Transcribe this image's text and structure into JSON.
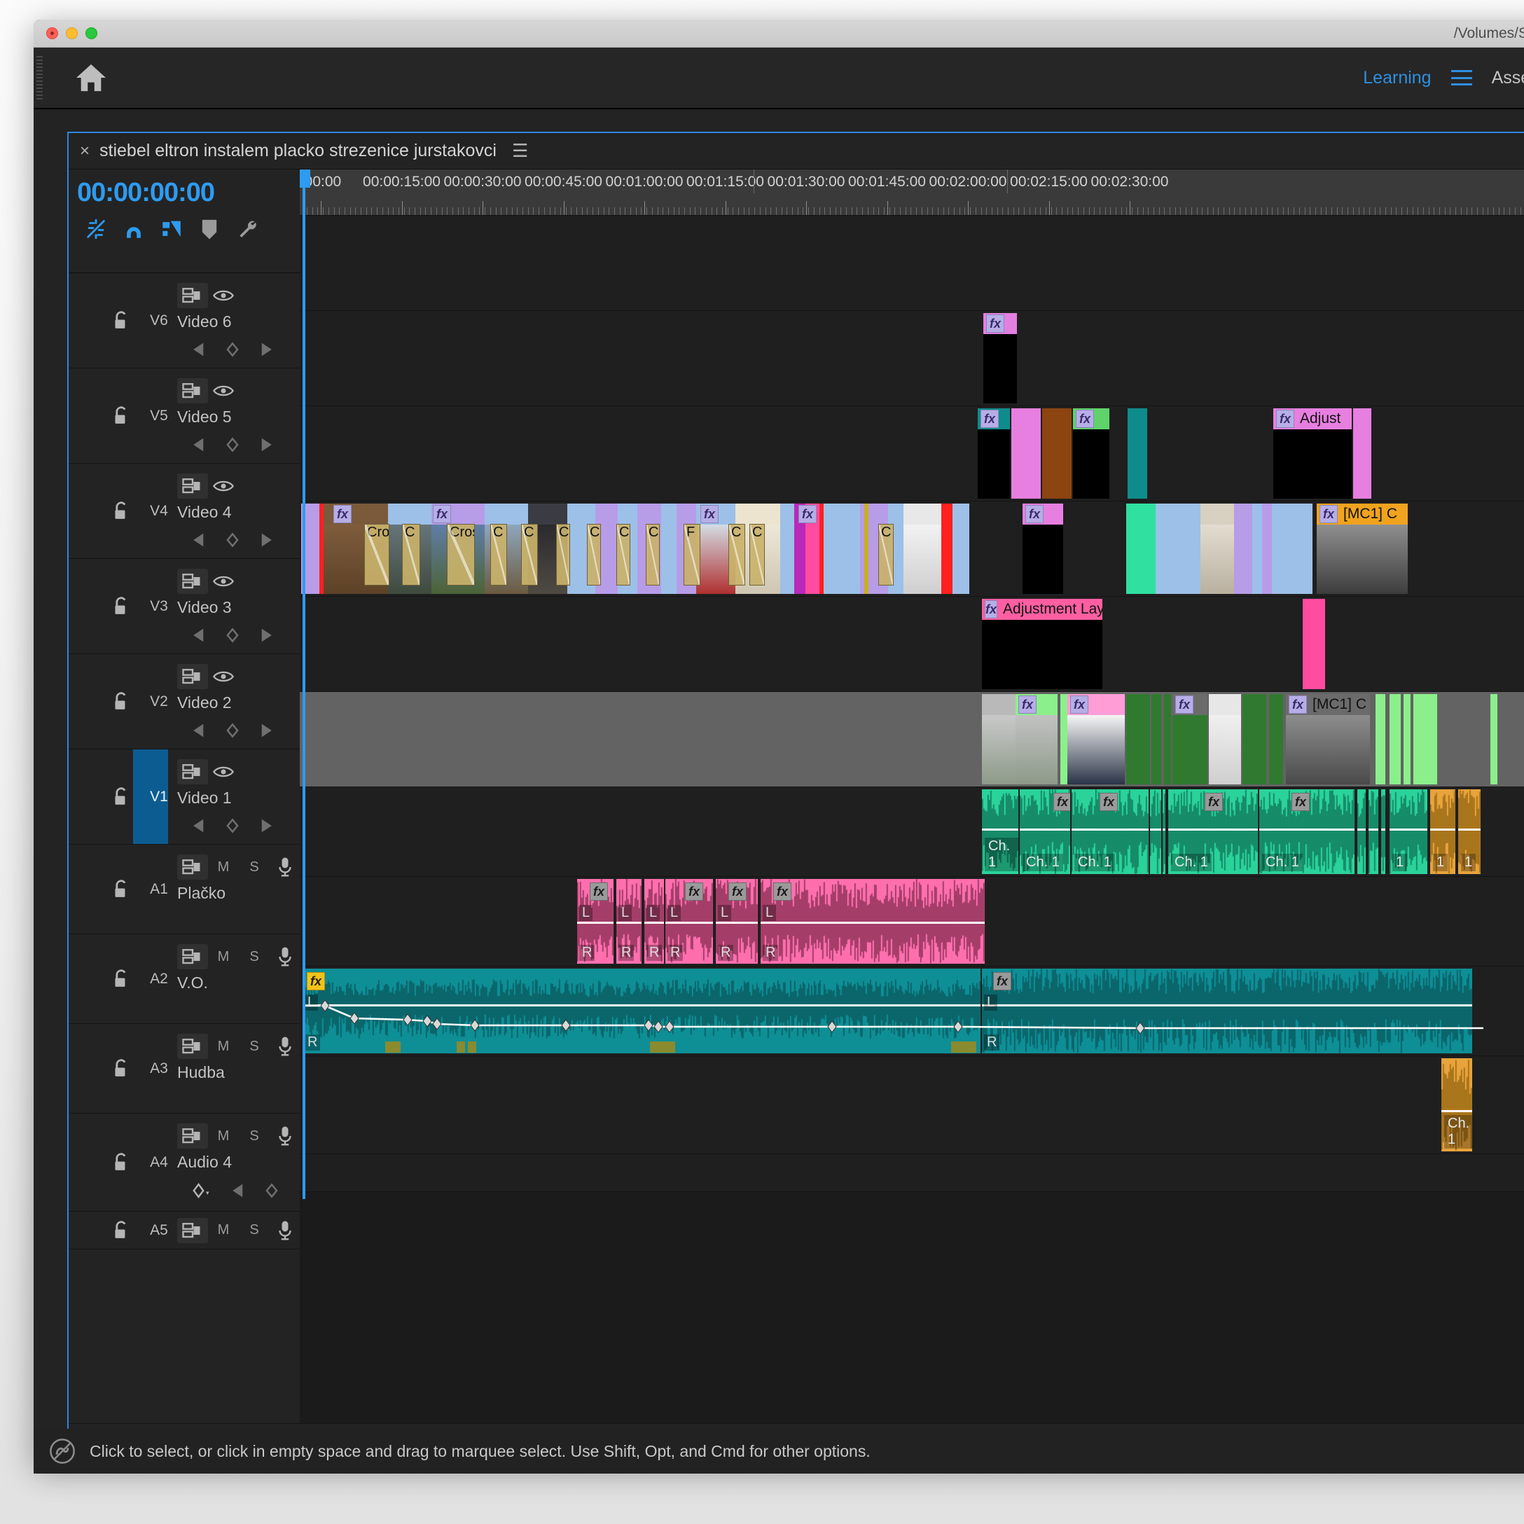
{
  "window": {
    "path_title": "/Volumes/SA",
    "traffic_lights": [
      "close",
      "minimize",
      "zoom"
    ]
  },
  "appbar": {
    "home_icon": "home-icon",
    "learning_label": "Learning",
    "menu_icon": "hamburger-icon",
    "workspace_label": "Assem"
  },
  "timeline_panel": {
    "tab": {
      "close_icon": "close-icon",
      "title": "stiebel eltron instalem placko strezenice jurstakovci",
      "menu_icon": "panel-menu-icon"
    },
    "timecode": "00:00:00:00",
    "tools": [
      {
        "name": "insert-overwrite-sync-lock-icon",
        "active": true
      },
      {
        "name": "snap-magnet-icon",
        "active": true
      },
      {
        "name": "linked-selection-icon",
        "active": true
      },
      {
        "name": "add-marker-icon",
        "active": false
      },
      {
        "name": "timeline-settings-wrench-icon",
        "active": false
      }
    ],
    "ruler": {
      "labels": [
        ":00:00",
        "00:00:15:00",
        "00:00:30:00",
        "00:00:45:00",
        "00:01:00:00",
        "00:01:15:00",
        "00:01:30:00",
        "00:01:45:00",
        "00:02:00:00",
        "00:02:15:00",
        "00:02:30:00"
      ]
    },
    "tracks": [
      {
        "id": "V6",
        "name": "Video 6",
        "kind": "video",
        "selected": false,
        "controls": [
          "toggle-track-targeting-icon",
          "toggle-track-output-eye-icon"
        ],
        "keyframe_nav": true
      },
      {
        "id": "V5",
        "name": "Video 5",
        "kind": "video",
        "selected": false,
        "controls": [
          "toggle-track-targeting-icon",
          "toggle-track-output-eye-icon"
        ],
        "keyframe_nav": true
      },
      {
        "id": "V4",
        "name": "Video 4",
        "kind": "video",
        "selected": false,
        "controls": [
          "toggle-track-targeting-icon",
          "toggle-track-output-eye-icon"
        ],
        "keyframe_nav": true
      },
      {
        "id": "V3",
        "name": "Video 3",
        "kind": "video",
        "selected": false,
        "controls": [
          "toggle-track-targeting-icon",
          "toggle-track-output-eye-icon"
        ],
        "keyframe_nav": true
      },
      {
        "id": "V2",
        "name": "Video 2",
        "kind": "video",
        "selected": false,
        "controls": [
          "toggle-track-targeting-icon",
          "toggle-track-output-eye-icon"
        ],
        "keyframe_nav": true
      },
      {
        "id": "V1",
        "name": "Video 1",
        "kind": "video",
        "selected": true,
        "controls": [
          "toggle-track-targeting-icon",
          "toggle-track-output-eye-icon"
        ],
        "keyframe_nav": true
      },
      {
        "id": "A1",
        "name": "Plačko",
        "kind": "audio",
        "selected": false,
        "controls": [
          "toggle-track-targeting-icon",
          "M",
          "S",
          "voice-over-mic-icon"
        ],
        "keyframe_nav": false
      },
      {
        "id": "A2",
        "name": "V.O.",
        "kind": "audio",
        "selected": false,
        "controls": [
          "toggle-track-targeting-icon",
          "M",
          "S",
          "voice-over-mic-icon"
        ],
        "keyframe_nav": false
      },
      {
        "id": "A3",
        "name": "Hudba",
        "kind": "audio",
        "selected": false,
        "controls": [
          "toggle-track-targeting-icon",
          "M",
          "S",
          "voice-over-mic-icon"
        ],
        "keyframe_nav": false
      },
      {
        "id": "A4",
        "name": "Audio 4",
        "kind": "audio",
        "selected": false,
        "controls": [
          "toggle-track-targeting-icon",
          "M",
          "S",
          "voice-over-mic-icon"
        ],
        "keyframe_nav": true
      },
      {
        "id": "A5",
        "name": "",
        "kind": "audio",
        "selected": false,
        "controls": [
          "toggle-track-targeting-icon",
          "M",
          "S",
          "voice-over-mic-icon"
        ],
        "keyframe_nav": false
      }
    ],
    "clip_labels": {
      "adjustment_layer_v2": "Adjustment Laye",
      "adjust_v4": "Adjust",
      "mc1_v3": "[MC1] C",
      "mc1_v1": "[MC1] C",
      "transition_long": "Cros",
      "transition_short": "C",
      "transition_f": "F",
      "audio_channel": "Ch. 1",
      "audio_channel_short": "1",
      "audio_left": "L",
      "audio_right": "R"
    }
  },
  "statusbar": {
    "icon": "creative-cloud-icon",
    "message": "Click to select, or click in empty space and drag to marquee select. Use Shift, Opt, and Cmd for other options."
  }
}
